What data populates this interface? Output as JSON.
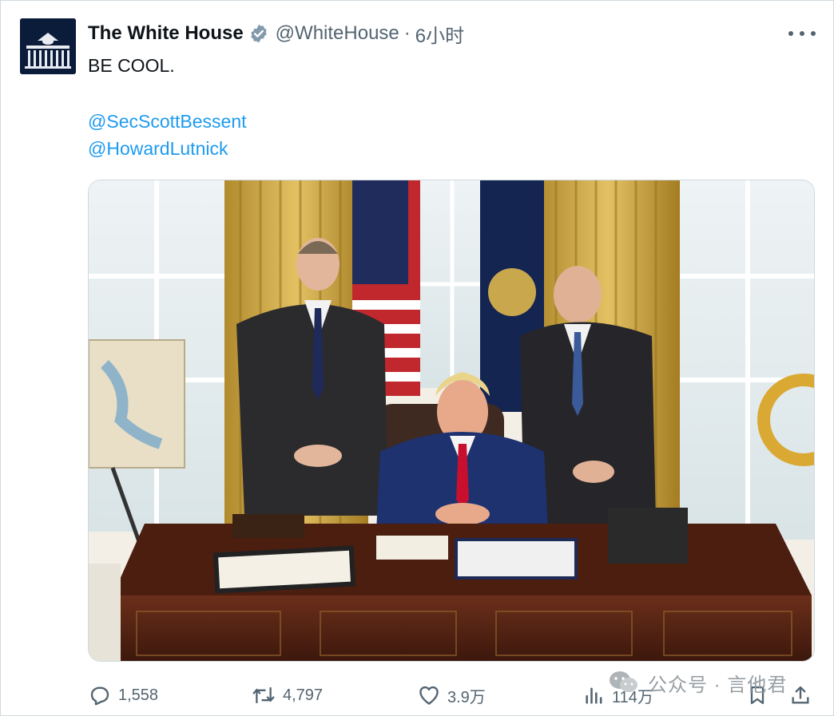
{
  "account": {
    "name": "The White House",
    "handle": "@WhiteHouse",
    "separator": "·",
    "time": "6小时",
    "verified": true,
    "avatar_icon": "white-house-logo-icon"
  },
  "tweet": {
    "text": "BE COOL.",
    "mentions": [
      "@SecScottBessent",
      "@HowardLutnick"
    ]
  },
  "media": {
    "type": "photo",
    "description_icon": "oval-office-photo"
  },
  "actions": {
    "replies": "1,558",
    "reposts": "4,797",
    "likes": "3.9万",
    "views": "114万"
  },
  "watermark": {
    "text": "公众号 · 言他君"
  },
  "colors": {
    "link": "#1d9bf0",
    "secondary_text": "#536471",
    "badge": "#829aab",
    "border": "#cfd9de"
  }
}
